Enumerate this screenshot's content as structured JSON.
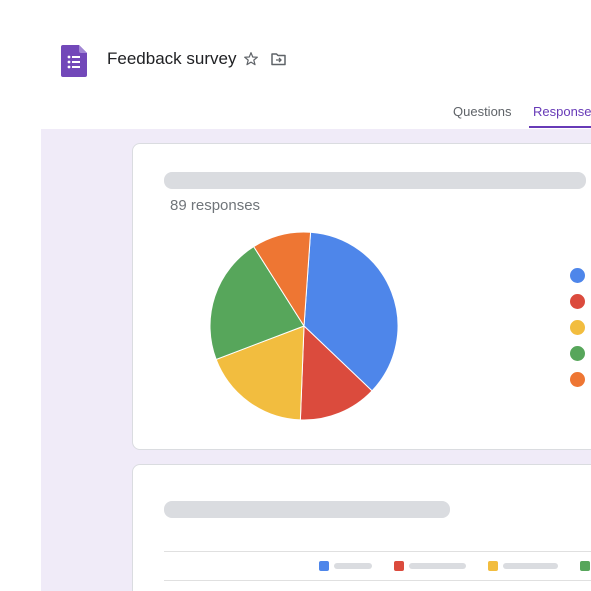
{
  "header": {
    "title": "Feedback survey",
    "app_icon": "forms-icon",
    "star_icon": "star-icon",
    "folder_icon": "move-to-folder-icon"
  },
  "tabs": [
    {
      "label": "Questions",
      "active": false
    },
    {
      "label": "Responses",
      "active": true
    }
  ],
  "colors": {
    "accent": "#673ab7",
    "background": "#f0ebf8",
    "forms_icon": "#7248b9",
    "series": [
      "#4e86ea",
      "#db4b3d",
      "#f2bd3f",
      "#57a65b",
      "#ee7633"
    ]
  },
  "summary": {
    "responses_label": "89 responses"
  },
  "chart_data": {
    "type": "pie",
    "slices": [
      {
        "color": "#4e86ea",
        "value": 36.0
      },
      {
        "color": "#db4b3d",
        "value": 13.5
      },
      {
        "color": "#f2bd3f",
        "value": 18.6
      },
      {
        "color": "#57a65b",
        "value": 21.8
      },
      {
        "color": "#ee7633",
        "value": 10.1
      }
    ],
    "legend": "right"
  }
}
